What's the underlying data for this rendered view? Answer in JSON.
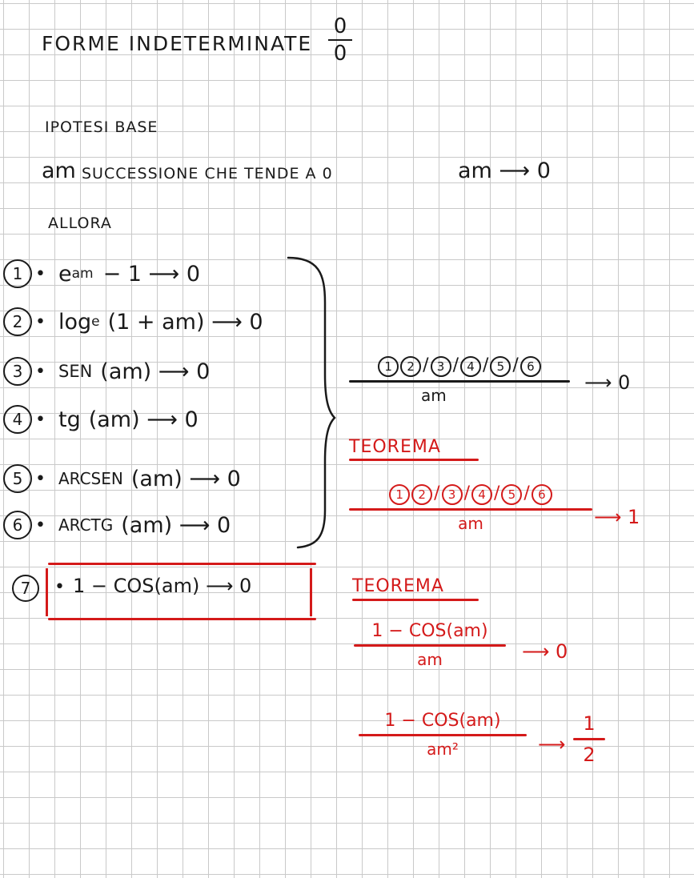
{
  "title": "FORME INDETERMINATE",
  "title_fraction": {
    "numerator": "0",
    "denominator": "0"
  },
  "ipotesi_label": "IPOTESI BASE",
  "hypothesis": {
    "sequence": "am",
    "statement": "SUCCESSIONE CHE TENDE A 0",
    "limit": "am ⟶ 0"
  },
  "allora_label": "ALLORA",
  "items": [
    {
      "number": "1",
      "html_main": "e",
      "sup": "am",
      "rest": "− 1 ⟶ 0"
    },
    {
      "number": "2",
      "html_main": "log",
      "sub": "e",
      "rest": "(1 + am) ⟶ 0"
    },
    {
      "number": "3",
      "html_main": "SEN",
      "rest": "(am) ⟶ 0"
    },
    {
      "number": "4",
      "html_main": "tg",
      "rest": "(am) ⟶ 0"
    },
    {
      "number": "5",
      "html_main": "ARCSEN",
      "rest": "(am) ⟶ 0"
    },
    {
      "number": "6",
      "html_main": "ARCTG",
      "rest": "(am) ⟶ 0"
    }
  ],
  "item7": {
    "number": "7",
    "expr": "1 − COS(am) ⟶ 0"
  },
  "first_result": {
    "numerator": [
      "1",
      "2",
      "3",
      "4",
      "5",
      "6"
    ],
    "denominator": "am",
    "arrow": "⟶ 0"
  },
  "theorem1": {
    "label": "TEOREMA",
    "numerator": [
      "1",
      "2",
      "3",
      "4",
      "5",
      "6"
    ],
    "denominator": "am",
    "arrow": "⟶ 1"
  },
  "theorem2": {
    "label": "TEOREMA",
    "frac1": {
      "numerator": "1 − COS(am)",
      "denominator": "am",
      "arrow": "⟶ 0"
    },
    "frac2": {
      "numerator": "1 − COS(am)",
      "denominator": "am²",
      "arrow": "⟶",
      "result_num": "1",
      "result_den": "2"
    }
  },
  "colors": {
    "ink": "#1a1a1a",
    "accent": "#d41a1a",
    "grid": "#c9c9c9"
  }
}
